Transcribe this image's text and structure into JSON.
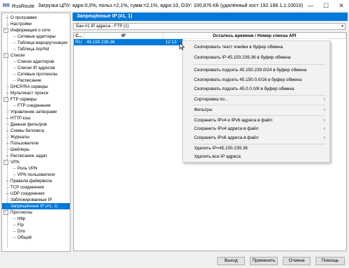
{
  "app": {
    "logo": "RR",
    "name": "RusRoute",
    "stats": "Загрузка ЦПУ: ядро:0,0%, польз.=2,1%, сумм:=2,1%, ядро:10,  ОЗУ: 100,876 КБ (удалённый хост 192.168.1.1:10010)"
  },
  "window": {
    "minimize": "—",
    "maximize": "☐",
    "close": "✕"
  },
  "sidebar": {
    "items": [
      {
        "label": "О программе"
      },
      {
        "label": "Настройки"
      },
      {
        "label": "Информация о сети"
      },
      {
        "label": "Сетевые адаптеры"
      },
      {
        "label": "Таблица маршрутизации"
      },
      {
        "label": "Таблица Arp/Nd"
      },
      {
        "label": "Списки"
      },
      {
        "label": "Списки адаптеров"
      },
      {
        "label": "Списки IP адресов"
      },
      {
        "label": "Сетевые протоколы"
      },
      {
        "label": "Расписание"
      },
      {
        "label": "DHCP/RA серверы"
      },
      {
        "label": "Мультикаст прокси"
      },
      {
        "label": "FTP серверы"
      },
      {
        "label": "FTP соединения"
      },
      {
        "label": "Управление затворами"
      },
      {
        "label": "HTTP кэш"
      },
      {
        "label": "Данные фильтров"
      },
      {
        "label": "Схемы биллинга"
      },
      {
        "label": "Журналы"
      },
      {
        "label": "Пользователи"
      },
      {
        "label": "Шейперы"
      },
      {
        "label": "Расписание задач"
      },
      {
        "label": "VPN"
      },
      {
        "label": "Роль VPN"
      },
      {
        "label": "VPN пользователи"
      },
      {
        "label": "Правила файервола"
      },
      {
        "label": "TCP соединения"
      },
      {
        "label": "UDP соединения"
      },
      {
        "label": "Заблокированные IP"
      },
      {
        "label": "Запрещённые IP (#1, 1)"
      },
      {
        "label": "Протоколы"
      },
      {
        "label": "Http"
      },
      {
        "label": "Ftp"
      },
      {
        "label": "Dns"
      },
      {
        "label": "Общий"
      }
    ]
  },
  "panel": {
    "title": "Запрещённые IP (#1, 1)"
  },
  "filter": {
    "value": "Бан #1 IP адреса - FTP (1)",
    "arrow": "▾"
  },
  "table": {
    "headers": [
      "С...",
      "IP",
      "Осталось времени / Номер списка API"
    ],
    "rows": [
      {
        "c": "RU",
        "ip": "45.150.239.36",
        "time": "12:13"
      }
    ]
  },
  "context_menu": {
    "items": [
      {
        "label": "Скопировать текст ячейки в буфер обмена"
      },
      {
        "label": "Скопировать IP 45.150.239.36 в буфер обмена"
      },
      {
        "label": "Скопировать подсеть 45.150.239.0/24 в буфер обмена"
      },
      {
        "label": "Скопировать подсеть 45.150.0.0/16 в буфер обмена"
      },
      {
        "label": "Скопировать подсеть 45.0.0.0/8 в буфер обмена"
      },
      {
        "label": "Сортировка по..."
      },
      {
        "label": "Фильтры"
      },
      {
        "label": "Сохранить IPv4 и IPv6 адреса в файл"
      },
      {
        "label": "Сохранить IPv4 адреса в файл"
      },
      {
        "label": "Сохранить IPv6 адреса в файл"
      },
      {
        "label": "Удалить IP=45.150.239.36"
      },
      {
        "label": "Удалить все IP адреса"
      }
    ],
    "submenu_glyph": "›"
  },
  "buttons": {
    "exit": "Выход",
    "apply": "Применить",
    "cancel": "Отмена",
    "help": "Помощь"
  }
}
